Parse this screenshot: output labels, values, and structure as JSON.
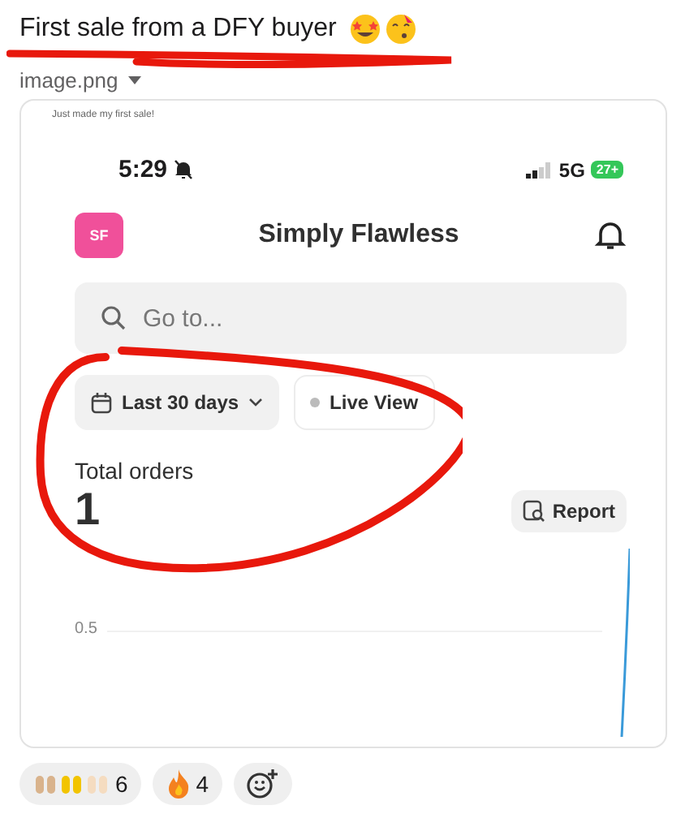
{
  "message": {
    "text": "First sale from a DFY buyer",
    "attachment_name": "image.png"
  },
  "screenshot": {
    "caption": "Just made my first sale!",
    "time": "5:29",
    "network": "5G",
    "battery": "27+",
    "store": {
      "initials": "SF",
      "name": "Simply Flawless"
    },
    "search": {
      "placeholder": "Go to..."
    },
    "filters": [
      {
        "label": "Last 30 days",
        "kind": "dropdown"
      },
      {
        "label": "Live View",
        "kind": "live"
      }
    ],
    "metric": {
      "label": "Total orders",
      "value": "1",
      "action": "Report"
    },
    "chart": {
      "tick_label": "0.5"
    }
  },
  "reactions": [
    {
      "kind": "hands",
      "count": "6"
    },
    {
      "kind": "fire",
      "count": "4"
    },
    {
      "kind": "add"
    }
  ]
}
